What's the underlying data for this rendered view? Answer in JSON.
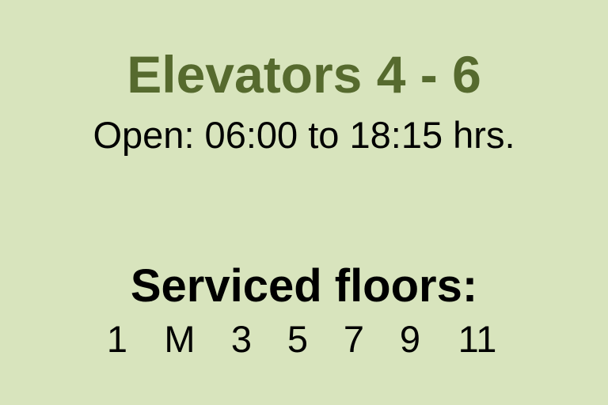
{
  "sign": {
    "title": "Elevators 4 - 6",
    "hours": "Open: 06:00 to 18:15 hrs.",
    "floors_heading": "Serviced floors:",
    "floors": [
      "1",
      "M",
      "3",
      "5",
      "7",
      "9",
      "11"
    ]
  },
  "colors": {
    "background": "#d8e4bd",
    "title": "#566a2e",
    "text": "#000000"
  }
}
